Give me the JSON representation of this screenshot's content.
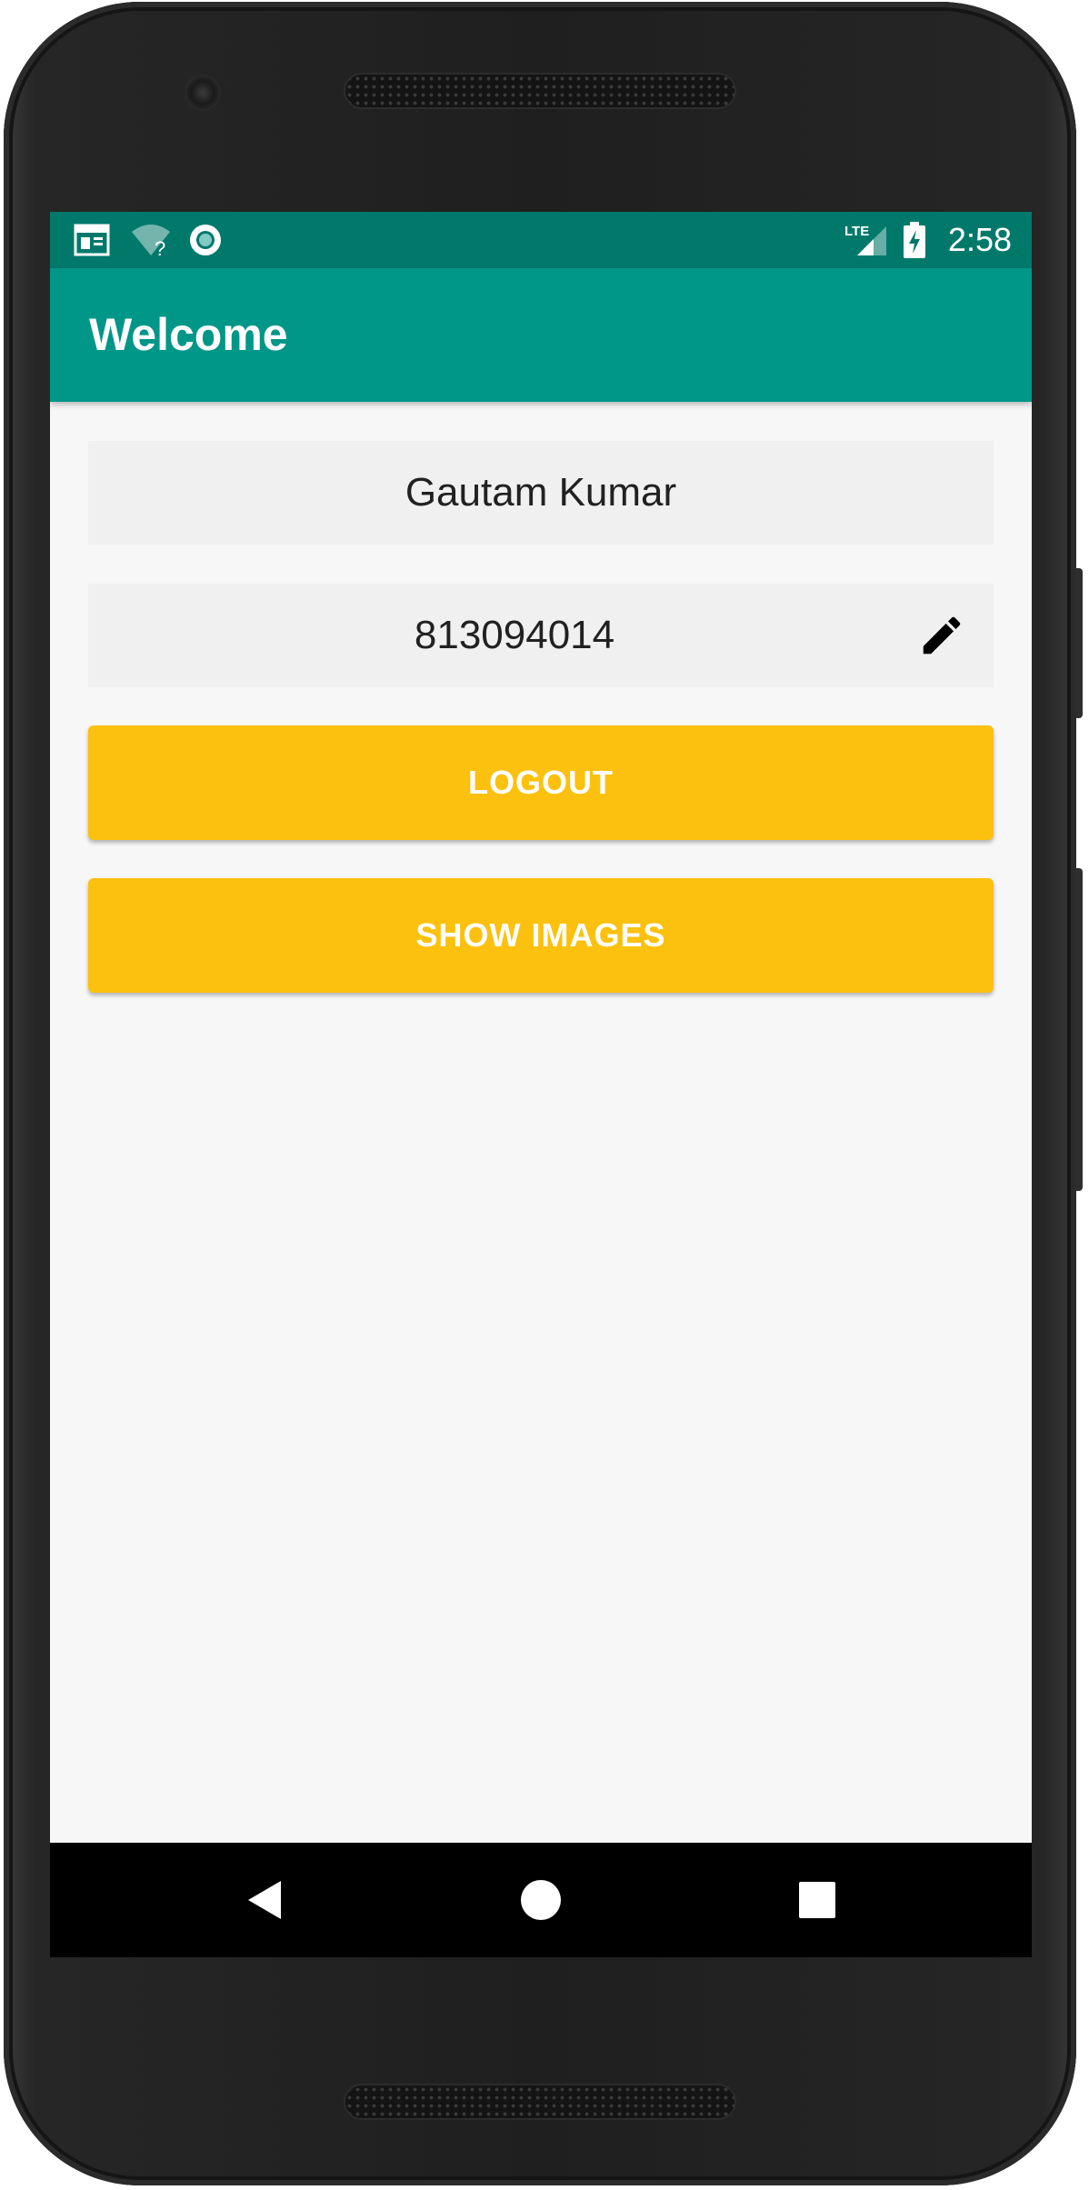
{
  "status_bar": {
    "time": "2:58",
    "network_label": "LTE",
    "icons": [
      "notification-calendar-icon",
      "wifi-unknown-icon",
      "sync-circle-icon",
      "lte-signal-icon",
      "battery-charging-icon"
    ]
  },
  "app_bar": {
    "title": "Welcome"
  },
  "profile": {
    "name": "Gautam Kumar",
    "phone": "813094014",
    "edit_icon": "pencil-edit-icon"
  },
  "actions": {
    "logout_label": "LOGOUT",
    "show_images_label": "SHOW IMAGES"
  },
  "nav_bar": {
    "icons": [
      "back-triangle-icon",
      "home-circle-icon",
      "recents-square-icon"
    ]
  },
  "colors": {
    "status_bar": "#00796b",
    "app_bar": "#009688",
    "button": "#fbc10e",
    "field_background": "#f0f0f0",
    "screen_background": "#f7f7f7"
  }
}
